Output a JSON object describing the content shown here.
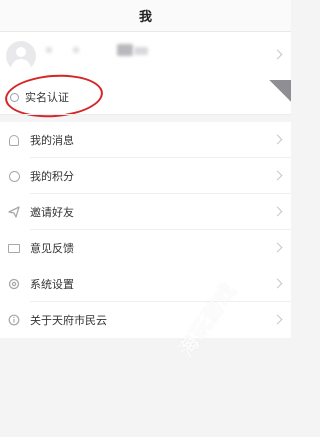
{
  "header": {
    "title": "我"
  },
  "verify": {
    "label": "实名认证",
    "icon": "badge-icon"
  },
  "menu_group_1": [
    {
      "label": "我的消息",
      "icon": "bell-icon"
    },
    {
      "label": "我的积分",
      "icon": "points-icon"
    },
    {
      "label": "邀请好友",
      "icon": "send-icon"
    },
    {
      "label": "意见反馈",
      "icon": "envelope-icon"
    }
  ],
  "menu_group_2": [
    {
      "label": "系统设置",
      "icon": "gear-icon"
    },
    {
      "label": "关于天府市民云",
      "icon": "info-icon"
    }
  ],
  "watermark": {
    "text": "海玩游戏"
  },
  "colors": {
    "highlight_circle": "#d62525",
    "background": "#f4f4f5"
  }
}
